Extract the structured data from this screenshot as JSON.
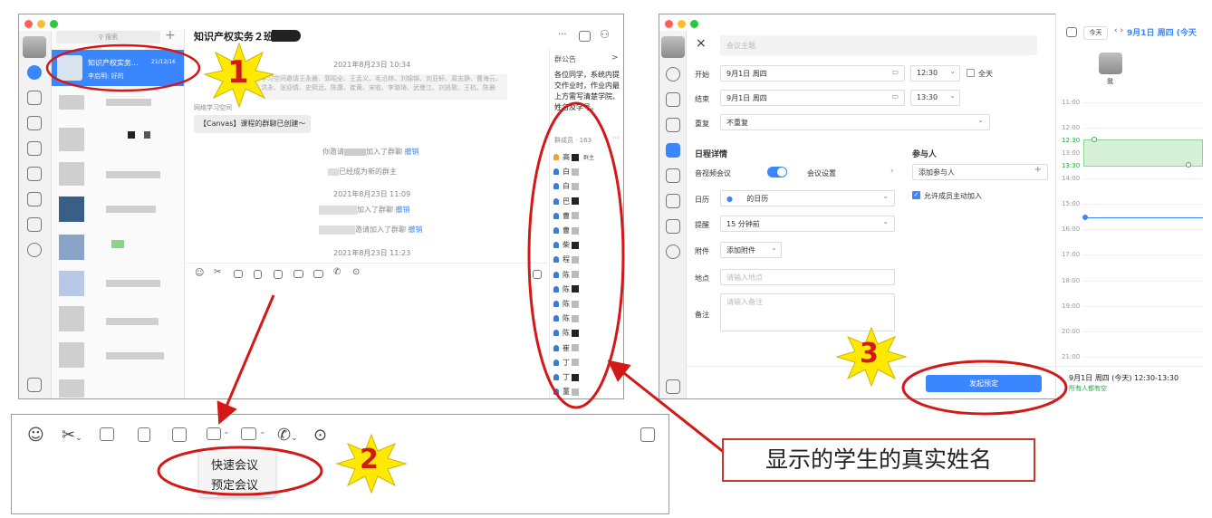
{
  "chat": {
    "search_placeholder": "搜索",
    "plus": "+",
    "selected": {
      "name": "知识产权实务...",
      "time": "21/12/16",
      "preview": "李启明: 好的"
    },
    "title": "知识产权实务２班",
    "header_more": "···",
    "messages": {
      "ts1": "2021年8月23日 10:34",
      "invite_text": "学习空间邀请王永晨、郭昭全、王孟义、毛沿林、刘锦锦、刘亚轩、周志静、曹海元、洪永、张迎倩、史熙远、陈康、崔黄、宋收、李璐琦、武曼江、刘凯歌、王杭、陈晨",
      "sender": "网络学习空间",
      "bubble": "【Canvas】课程的群聊已创建～",
      "sys1": "你邀请",
      "sys1b": "加入了群聊",
      "revoke": "撤销",
      "sys2": "已经成为新的群主",
      "ts2": "2021年8月23日 11:09",
      "sys3": "加入了群聊",
      "sys4": "邀请加入了群聊",
      "ts3": "2021年8月23日 11:23"
    },
    "announcement": {
      "label": "群公告",
      "arrow": ">",
      "text1": "各位同学，系统内提",
      "text2": "交作业时，作业内最",
      "text3": "上方需写清楚学院、",
      "text4": "姓名及学号。"
    },
    "members": {
      "label": "群成员 · 163",
      "more": "···",
      "items": [
        "高",
        "白",
        "白",
        "巴",
        "曹",
        "曹",
        "柴",
        "程",
        "陈",
        "陈",
        "陈",
        "陈",
        "陈",
        "崔",
        "丁",
        "丁",
        "董"
      ],
      "owner_tag": "群主"
    }
  },
  "zoom_toolbar": {
    "menu": [
      "快速会议",
      "预定会议"
    ]
  },
  "annotation": {
    "n1": "1",
    "n2": "2",
    "n3": "3",
    "callout": "显示的学生的真实姓名"
  },
  "meeting": {
    "close": "×",
    "title_placeholder": "会议主题",
    "start_label": "开始",
    "start_date": "9月1日 周四",
    "start_time": "12:30",
    "allday": "全天",
    "end_label": "结束",
    "end_date": "9月1日 周四",
    "end_time": "13:30",
    "repeat_label": "重复",
    "repeat_value": "不重复",
    "detail_heading": "日程详情",
    "video_label": "音视频会议",
    "settings_label": "会议设置",
    "calendar_label": "日历",
    "calendar_value": "的日历",
    "remind_label": "提醒",
    "remind_value": "15 分钟前",
    "attach_label": "附件",
    "attach_button": "添加附件",
    "location_label": "地点",
    "location_placeholder": "请输入地点",
    "note_label": "备注",
    "note_placeholder": "请输入备注",
    "participants_heading": "参与人",
    "add_participant": "添加参与人",
    "allow_label": "允许成员主动加入",
    "submit": "发起预定",
    "today": "今天",
    "date_header": "9月1日 周四 (今天",
    "me": "我",
    "hours": [
      "11:00",
      "12:00",
      "12:30",
      "13:00",
      "13:30",
      "14:00",
      "15:00",
      "16:00",
      "17:00",
      "18:00",
      "19:00",
      "20:00",
      "21:00"
    ],
    "summary": "9月1日 周四 (今天) 12:30-13:30",
    "availability": "所有人都有空"
  },
  "colors": {
    "accent": "#3a86ff",
    "red": "#d31818",
    "green": "#28a745",
    "yellow": "#ffe900"
  }
}
